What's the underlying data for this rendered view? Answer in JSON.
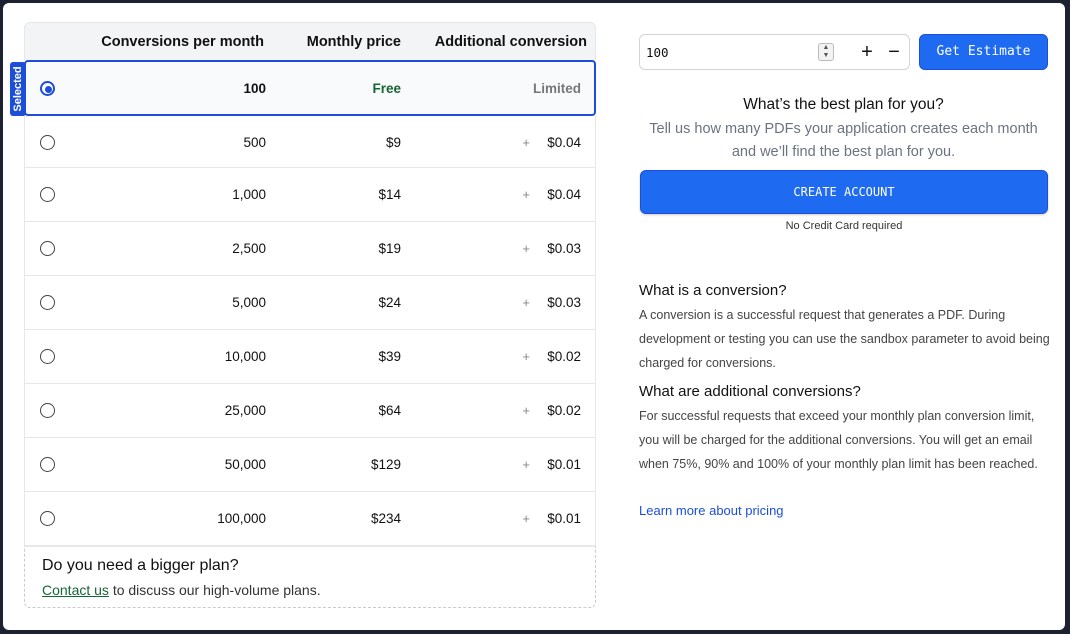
{
  "table": {
    "headers": {
      "conversions": "Conversions per month",
      "price": "Monthly price",
      "additional": "Additional conversion"
    },
    "selected_badge": "Selected",
    "rows": [
      {
        "conversions": "100",
        "price": "Free",
        "plus": "",
        "additional": "Limited",
        "selected": true
      },
      {
        "conversions": "500",
        "price": "$9",
        "plus": "+",
        "additional": "$0.04",
        "selected": false
      },
      {
        "conversions": "1,000",
        "price": "$14",
        "plus": "+",
        "additional": "$0.04",
        "selected": false
      },
      {
        "conversions": "2,500",
        "price": "$19",
        "plus": "+",
        "additional": "$0.03",
        "selected": false
      },
      {
        "conversions": "5,000",
        "price": "$24",
        "plus": "+",
        "additional": "$0.03",
        "selected": false
      },
      {
        "conversions": "10,000",
        "price": "$39",
        "plus": "+",
        "additional": "$0.02",
        "selected": false
      },
      {
        "conversions": "25,000",
        "price": "$64",
        "plus": "+",
        "additional": "$0.02",
        "selected": false
      },
      {
        "conversions": "50,000",
        "price": "$129",
        "plus": "+",
        "additional": "$0.01",
        "selected": false
      },
      {
        "conversions": "100,000",
        "price": "$234",
        "plus": "+",
        "additional": "$0.01",
        "selected": false
      }
    ],
    "bigger": {
      "title": "Do you need a bigger plan?",
      "link": "Contact us",
      "rest": " to discuss our high-volume plans."
    }
  },
  "estimator": {
    "quantity": "100",
    "plus_label": "+",
    "minus_label": "−",
    "button": "Get Estimate"
  },
  "best_plan": {
    "title": "What’s the best plan for you?",
    "subtitle": "Tell us how many PDFs your application creates each month and we’ll find the best plan for you."
  },
  "create_account": {
    "button": "CREATE ACCOUNT",
    "note": "No Credit Card required"
  },
  "faq": {
    "q1": "What is a conversion?",
    "a1": "A conversion is a successful request that generates a PDF. During development or testing you can use the sandbox parameter to avoid being charged for conversions.",
    "q2": "What are additional conversions?",
    "a2": "For successful requests that exceed your monthly plan conversion limit, you will be charged for the additional conversions. You will get an email when 75%, 90% and 100% of your monthly plan limit has been reached.",
    "learn_more": "Learn more about pricing"
  },
  "colors": {
    "accent": "#1e6bf2",
    "free_green": "#166534",
    "link_blue": "#1d4ed8"
  }
}
